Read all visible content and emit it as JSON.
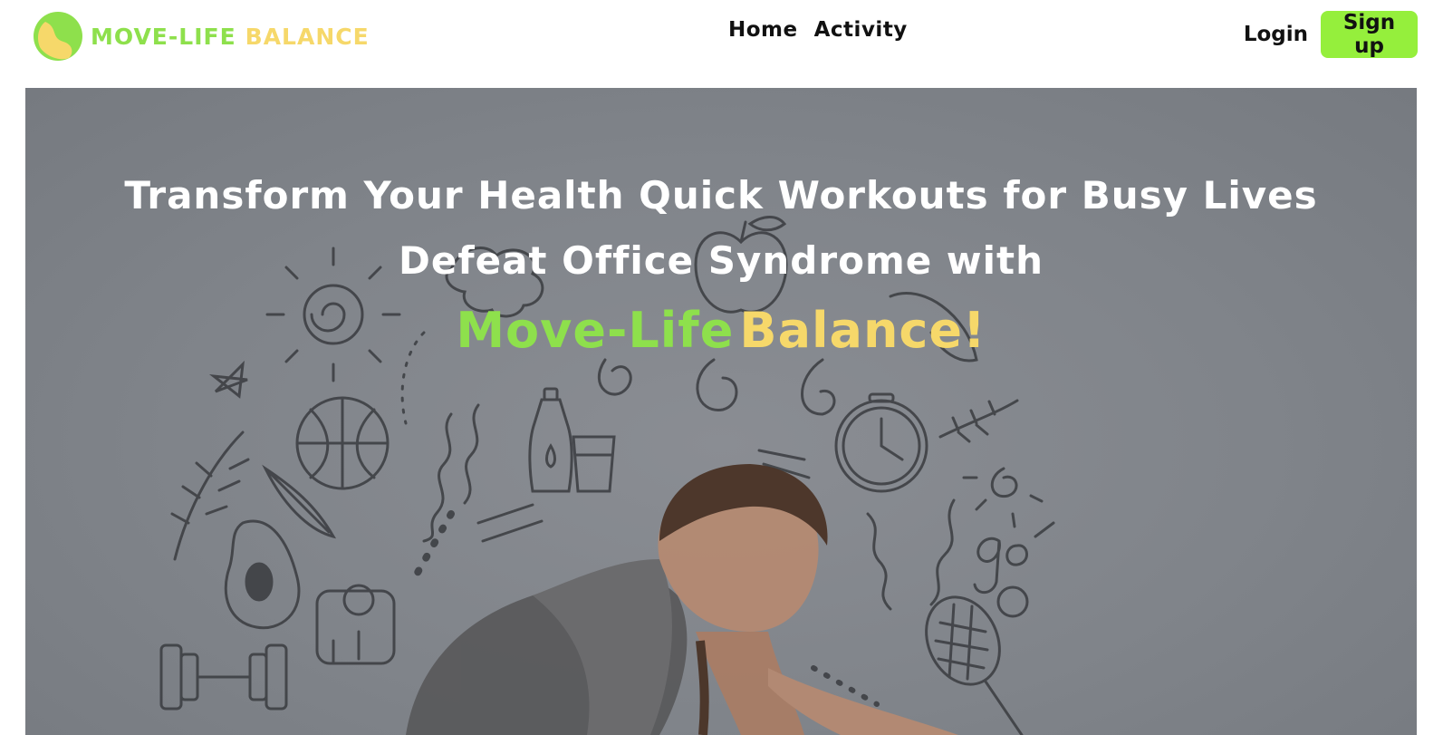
{
  "brand": {
    "part1": "MOVE-LIFE",
    "part2": "BALANCE",
    "logo_icon": "leaf-ball-logo-icon"
  },
  "nav": {
    "home": "Home",
    "activity": "Activity"
  },
  "auth": {
    "login": "Login",
    "signup": "Sign up"
  },
  "hero": {
    "line1": "Transform Your Health Quick Workouts for Busy Lives",
    "line2": "Defeat Office Syndrome with",
    "highlight_move": "Move-Life",
    "highlight_balance": "Balance!",
    "image_description_icon": "fitness-doodles-woman-stretching-illustration"
  },
  "colors": {
    "accent_green": "#95ef3c",
    "brand_green": "#8ee04c",
    "brand_yellow": "#f6d86a",
    "hero_bg": "#80848a"
  }
}
